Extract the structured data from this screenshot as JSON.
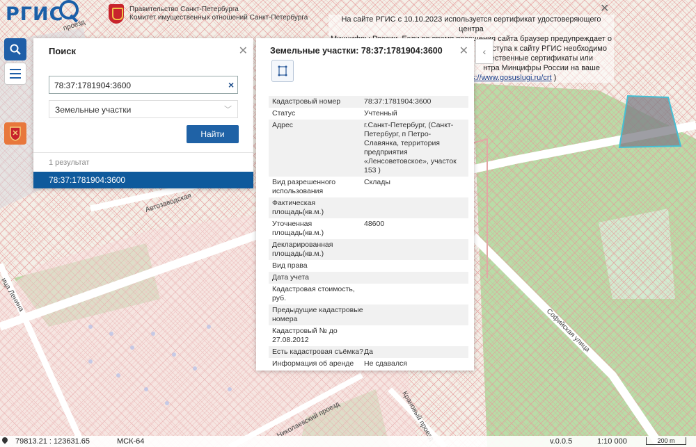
{
  "header": {
    "logo": "РГИС",
    "gov_line1": "Правительство Санкт-Петербурга",
    "gov_line2": "Комитет имущественных отношений Санкт-Петербурга"
  },
  "notice": {
    "line1": "На сайте РГИС с 10.10.2023 используется сертификат удостоверяющего центра",
    "line2": "Минцифры России. Если во время посещения сайта браузер предупреждает о",
    "line3": "доступа к сайту РГИС необходимо",
    "line4": "ечественные сертификаты или",
    "line5": "нтра Минцифры России на ваше",
    "link": "s://www.gosuslugi.ru/crt",
    "tail": ")"
  },
  "search": {
    "title": "Поиск",
    "query": "78:37:1781904:3600",
    "type": "Земельные участки",
    "button": "Найти",
    "result_count": "1 результат",
    "results": [
      "78:37:1781904:3600"
    ]
  },
  "info": {
    "title": "Земельные участки: 78:37:1781904:3600",
    "rows": [
      {
        "label": "Кадастровый номер",
        "value": "78:37:1781904:3600"
      },
      {
        "label": "Статус",
        "value": "Учтенный"
      },
      {
        "label": "Адрес",
        "value": "г.Санкт-Петербург, (Санкт-Петербург, п Петро-Славянка, территория предприятия «Ленсоветовское», участок 153 )"
      },
      {
        "label": "Вид разрешенного использования",
        "value": "Склады"
      },
      {
        "label": "Фактическая площадь(кв.м.)",
        "value": ""
      },
      {
        "label": "Уточненная площадь(кв.м.)",
        "value": "48600"
      },
      {
        "label": "Декларированная площадь(кв.м.)",
        "value": ""
      },
      {
        "label": "Вид права",
        "value": ""
      },
      {
        "label": "Дата учета",
        "value": ""
      },
      {
        "label": "Кадастровая стоимость, руб.",
        "value": ""
      },
      {
        "label": "Предыдущие кадастровые номера",
        "value": ""
      },
      {
        "label": "Кадастровый № до 27.08.2012",
        "value": ""
      },
      {
        "label": "Есть кадастровая съёмка?",
        "value": "Да"
      },
      {
        "label": "Информация об аренде",
        "value": "Не сдавался"
      }
    ]
  },
  "map_labels": {
    "road1": "Автозаводская",
    "road2": "ица Ленина",
    "road3": "Софийская улица",
    "road4": "Крановый проезд",
    "road5": "Николаевский проезд",
    "road6": "проезд"
  },
  "status": {
    "coords": "79813.21 : 123631.65",
    "crs": "МСК-64",
    "version": "v.0.0.5",
    "scale": "1:10 000",
    "bar": "200 m"
  },
  "colors": {
    "accent": "#1f5fa8",
    "selected": "#0f5a9c",
    "parcel_line": "#e07c7c",
    "green": "#bfe0b0"
  }
}
